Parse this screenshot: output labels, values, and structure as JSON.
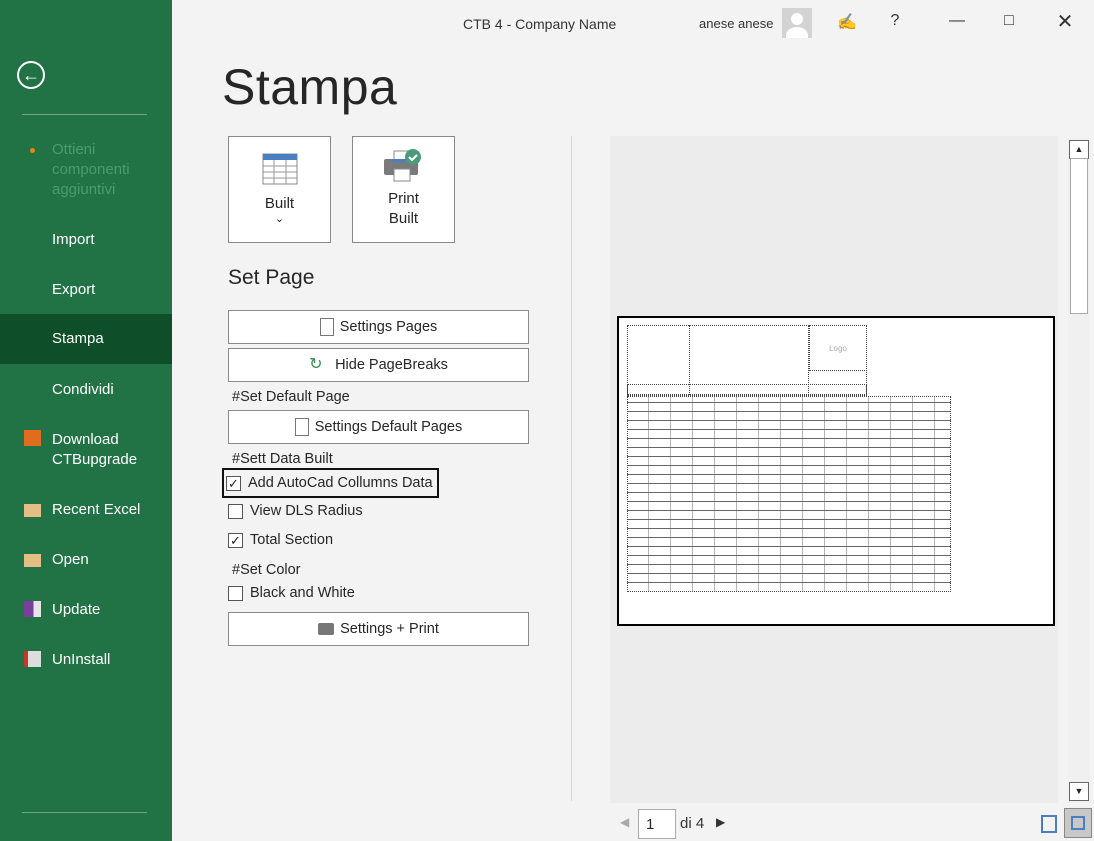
{
  "window": {
    "title": "CTB 4  -  Company Name",
    "user": "anese anese",
    "help": "?"
  },
  "sidebar": {
    "items": [
      {
        "label": "Ottieni componenti aggiuntivi",
        "disabled": true
      },
      {
        "label": "Import"
      },
      {
        "label": "Export"
      },
      {
        "label": "Stampa",
        "selected": true
      },
      {
        "label": "Condividi"
      },
      {
        "label": "Download CTBupgrade",
        "icon": "rss-download-icon"
      },
      {
        "label": "Recent Excel",
        "icon": "folder-icon"
      },
      {
        "label": "Open",
        "icon": "folder-icon"
      },
      {
        "label": "Update",
        "icon": "save-update-icon"
      },
      {
        "label": "UnInstall",
        "icon": "uninstall-icon"
      }
    ]
  },
  "main": {
    "title": "Stampa",
    "built_button": "Built",
    "print_built_button": [
      "Print",
      "Built"
    ],
    "set_page_heading": "Set Page",
    "settings_pages": "Settings Pages",
    "hide_pagebreaks": "Hide PageBreaks",
    "set_default_page_label": "#Set Default Page",
    "settings_default_pages": "Settings Default Pages",
    "sett_data_built_label": "#Sett Data Built",
    "checkboxes": [
      {
        "label": "Add AutoCad Collumns Data",
        "checked": true
      },
      {
        "label": "View DLS Radius",
        "checked": false
      },
      {
        "label": "Total Section",
        "checked": true
      }
    ],
    "set_color_label": "#Set Color",
    "bw_checkbox": {
      "label": "Black and White",
      "checked": false
    },
    "settings_print": "Settings + Print"
  },
  "preview": {
    "logo": "Logo",
    "page": "1",
    "of_pages": "di 4"
  },
  "colors": {
    "sidebar": "#217346",
    "selected": "#0e4f29",
    "accent_check": "#4c9a7a"
  }
}
